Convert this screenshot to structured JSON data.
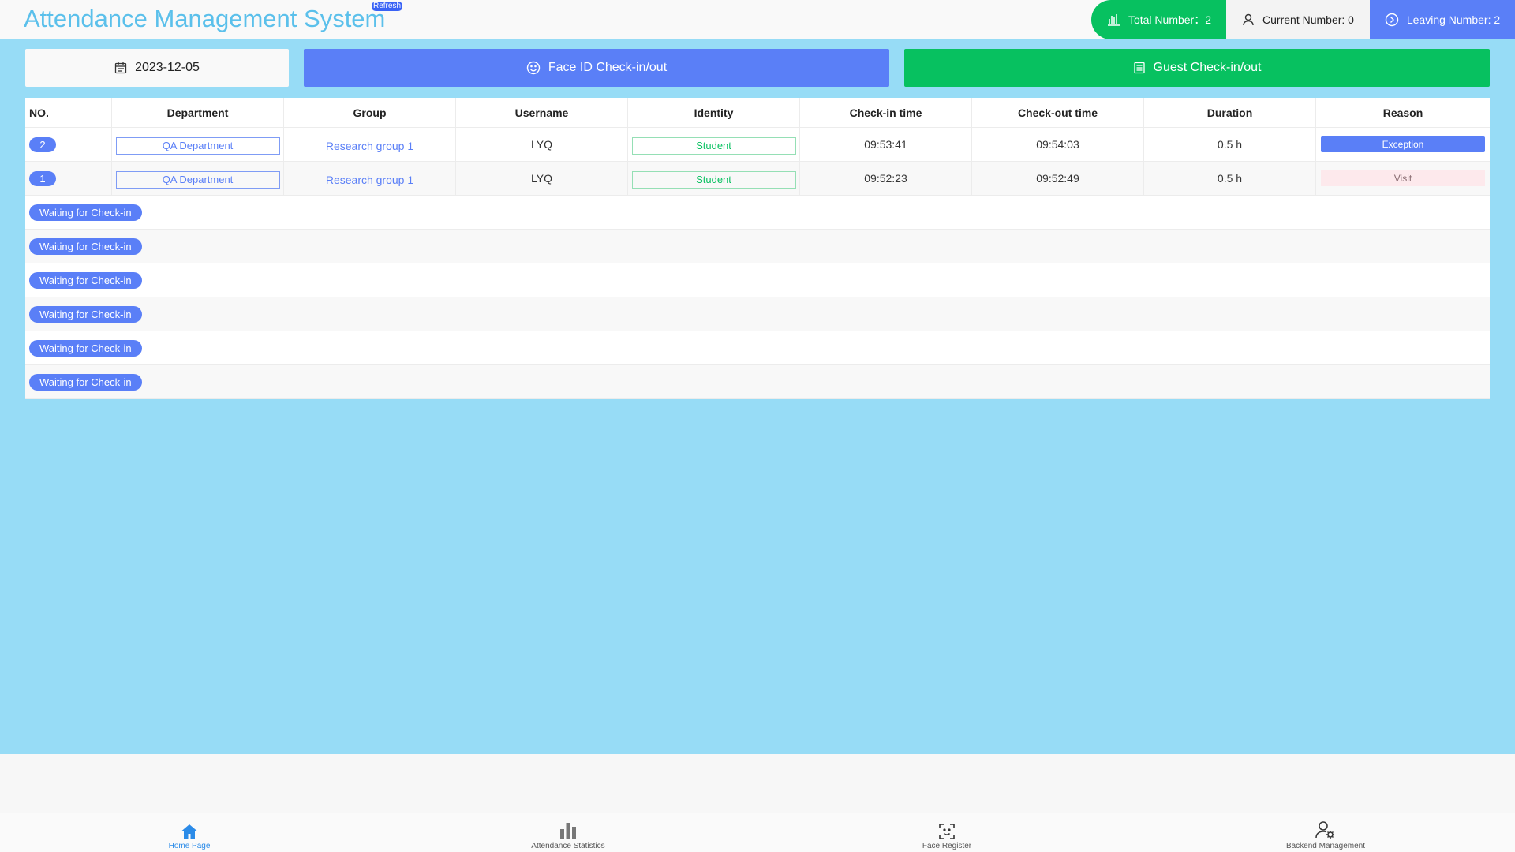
{
  "header": {
    "title": "Attendance Management System",
    "refresh_label": "Refresh",
    "stats": {
      "total": "Total Number：2",
      "current": "Current Number: 0",
      "leaving": "Leaving Number: 2"
    }
  },
  "actions": {
    "date": "2023-12-05",
    "face_id": "Face ID Check-in/out",
    "guest": "Guest Check-in/out"
  },
  "table": {
    "columns": [
      "NO.",
      "Department",
      "Group",
      "Username",
      "Identity",
      "Check-in time",
      "Check-out time",
      "Duration",
      "Reason"
    ],
    "rows": [
      {
        "no": "2",
        "department": "QA Department",
        "group": "Research group 1",
        "username": "LYQ",
        "identity": "Student",
        "checkin": "09:53:41",
        "checkout": "09:54:03",
        "duration": "0.5 h",
        "reason": "Exception"
      },
      {
        "no": "1",
        "department": "QA Department",
        "group": "Research group 1",
        "username": "LYQ",
        "identity": "Student",
        "checkin": "09:52:23",
        "checkout": "09:52:49",
        "duration": "0.5 h",
        "reason": "Visit"
      }
    ],
    "waiting": [
      "Waiting for Check-in",
      "Waiting for Check-in",
      "Waiting for Check-in",
      "Waiting for Check-in",
      "Waiting for Check-in",
      "Waiting for Check-in"
    ]
  },
  "bottom_nav": [
    {
      "label": "Home Page",
      "icon": "home-icon",
      "active": true
    },
    {
      "label": "Attendance Statistics",
      "icon": "bar-chart-icon",
      "active": false
    },
    {
      "label": "Face Register",
      "icon": "face-scan-icon",
      "active": false
    },
    {
      "label": "Backend Management",
      "icon": "user-settings-icon",
      "active": false
    }
  ],
  "colors": {
    "main_bg": "#97dcf6",
    "primary": "#5a7ff7",
    "success": "#07c160",
    "title": "#5bc0eb"
  }
}
